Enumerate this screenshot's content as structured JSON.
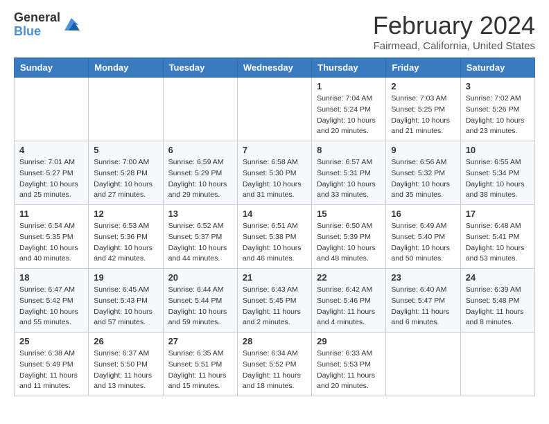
{
  "header": {
    "logo_general": "General",
    "logo_blue": "Blue",
    "month": "February 2024",
    "location": "Fairmead, California, United States"
  },
  "weekdays": [
    "Sunday",
    "Monday",
    "Tuesday",
    "Wednesday",
    "Thursday",
    "Friday",
    "Saturday"
  ],
  "weeks": [
    [
      null,
      null,
      null,
      null,
      {
        "day": "1",
        "sunrise": "7:04 AM",
        "sunset": "5:24 PM",
        "daylight": "10 hours and 20 minutes."
      },
      {
        "day": "2",
        "sunrise": "7:03 AM",
        "sunset": "5:25 PM",
        "daylight": "10 hours and 21 minutes."
      },
      {
        "day": "3",
        "sunrise": "7:02 AM",
        "sunset": "5:26 PM",
        "daylight": "10 hours and 23 minutes."
      }
    ],
    [
      {
        "day": "4",
        "sunrise": "7:01 AM",
        "sunset": "5:27 PM",
        "daylight": "10 hours and 25 minutes."
      },
      {
        "day": "5",
        "sunrise": "7:00 AM",
        "sunset": "5:28 PM",
        "daylight": "10 hours and 27 minutes."
      },
      {
        "day": "6",
        "sunrise": "6:59 AM",
        "sunset": "5:29 PM",
        "daylight": "10 hours and 29 minutes."
      },
      {
        "day": "7",
        "sunrise": "6:58 AM",
        "sunset": "5:30 PM",
        "daylight": "10 hours and 31 minutes."
      },
      {
        "day": "8",
        "sunrise": "6:57 AM",
        "sunset": "5:31 PM",
        "daylight": "10 hours and 33 minutes."
      },
      {
        "day": "9",
        "sunrise": "6:56 AM",
        "sunset": "5:32 PM",
        "daylight": "10 hours and 35 minutes."
      },
      {
        "day": "10",
        "sunrise": "6:55 AM",
        "sunset": "5:34 PM",
        "daylight": "10 hours and 38 minutes."
      }
    ],
    [
      {
        "day": "11",
        "sunrise": "6:54 AM",
        "sunset": "5:35 PM",
        "daylight": "10 hours and 40 minutes."
      },
      {
        "day": "12",
        "sunrise": "6:53 AM",
        "sunset": "5:36 PM",
        "daylight": "10 hours and 42 minutes."
      },
      {
        "day": "13",
        "sunrise": "6:52 AM",
        "sunset": "5:37 PM",
        "daylight": "10 hours and 44 minutes."
      },
      {
        "day": "14",
        "sunrise": "6:51 AM",
        "sunset": "5:38 PM",
        "daylight": "10 hours and 46 minutes."
      },
      {
        "day": "15",
        "sunrise": "6:50 AM",
        "sunset": "5:39 PM",
        "daylight": "10 hours and 48 minutes."
      },
      {
        "day": "16",
        "sunrise": "6:49 AM",
        "sunset": "5:40 PM",
        "daylight": "10 hours and 50 minutes."
      },
      {
        "day": "17",
        "sunrise": "6:48 AM",
        "sunset": "5:41 PM",
        "daylight": "10 hours and 53 minutes."
      }
    ],
    [
      {
        "day": "18",
        "sunrise": "6:47 AM",
        "sunset": "5:42 PM",
        "daylight": "10 hours and 55 minutes."
      },
      {
        "day": "19",
        "sunrise": "6:45 AM",
        "sunset": "5:43 PM",
        "daylight": "10 hours and 57 minutes."
      },
      {
        "day": "20",
        "sunrise": "6:44 AM",
        "sunset": "5:44 PM",
        "daylight": "10 hours and 59 minutes."
      },
      {
        "day": "21",
        "sunrise": "6:43 AM",
        "sunset": "5:45 PM",
        "daylight": "11 hours and 2 minutes."
      },
      {
        "day": "22",
        "sunrise": "6:42 AM",
        "sunset": "5:46 PM",
        "daylight": "11 hours and 4 minutes."
      },
      {
        "day": "23",
        "sunrise": "6:40 AM",
        "sunset": "5:47 PM",
        "daylight": "11 hours and 6 minutes."
      },
      {
        "day": "24",
        "sunrise": "6:39 AM",
        "sunset": "5:48 PM",
        "daylight": "11 hours and 8 minutes."
      }
    ],
    [
      {
        "day": "25",
        "sunrise": "6:38 AM",
        "sunset": "5:49 PM",
        "daylight": "11 hours and 11 minutes."
      },
      {
        "day": "26",
        "sunrise": "6:37 AM",
        "sunset": "5:50 PM",
        "daylight": "11 hours and 13 minutes."
      },
      {
        "day": "27",
        "sunrise": "6:35 AM",
        "sunset": "5:51 PM",
        "daylight": "11 hours and 15 minutes."
      },
      {
        "day": "28",
        "sunrise": "6:34 AM",
        "sunset": "5:52 PM",
        "daylight": "11 hours and 18 minutes."
      },
      {
        "day": "29",
        "sunrise": "6:33 AM",
        "sunset": "5:53 PM",
        "daylight": "11 hours and 20 minutes."
      },
      null,
      null
    ]
  ]
}
